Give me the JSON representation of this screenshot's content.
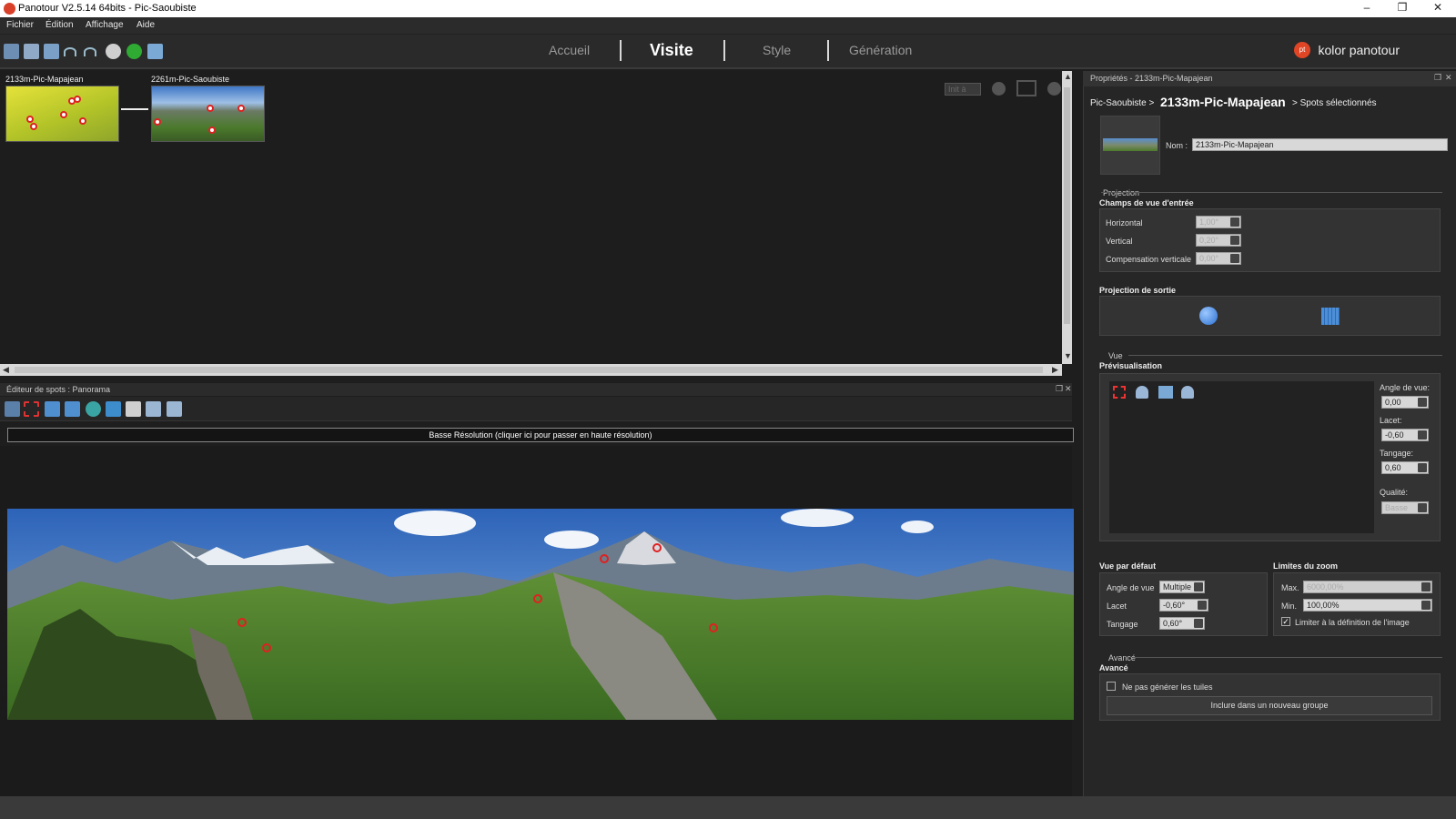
{
  "window": {
    "title": "Panotour V2.5.14 64bits - Pic-Saoubiste",
    "controls": [
      "–",
      "❐",
      "✕"
    ]
  },
  "menu": [
    "Fichier",
    "Édition",
    "Affichage",
    "Aide"
  ],
  "nav": {
    "tabs": [
      "Accueil",
      "Visite",
      "Style",
      "Génération"
    ],
    "active": "Visite",
    "brand": "kolor panotour",
    "brand_logo": "pt"
  },
  "tour": {
    "panos": [
      {
        "label": "2133m-Pic-Mapajean"
      },
      {
        "label": "2261m-Pic-Saoubiste"
      }
    ],
    "zoom_label": "Init à"
  },
  "editor": {
    "title": "Éditeur de spots : Panorama",
    "lowres_banner": "Basse Résolution (cliquer ici pour passer en haute résolution)"
  },
  "props": {
    "title": "Propriétés - 2133m-Pic-Mapajean",
    "breadcrumb_parent": "Pic-Saoubiste >",
    "breadcrumb_current": "2133m-Pic-Mapajean",
    "breadcrumb_tail": "> Spots sélectionnés",
    "name_label": "Nom :",
    "name_value": "2133m-Pic-Mapajean",
    "projection": {
      "section": "Projection",
      "group": "Champs de vue d'entrée",
      "horizontal_label": "Horizontal",
      "horizontal_value": "1,00°",
      "vertical_label": "Vertical",
      "vertical_value": "0,20°",
      "comp_label": "Compensation verticale",
      "comp_value": "0,00°",
      "output_label": "Projection de sortie"
    },
    "vue": {
      "section": "Vue",
      "group": "Prévisualisation",
      "angle_label": "Angle de vue:",
      "angle_value": "0,00",
      "lacet_label": "Lacet:",
      "lacet_value": "-0,60",
      "tangage_label": "Tangage:",
      "tangage_value": "0,60",
      "qualite_label": "Qualité:",
      "qualite_value": "Basse"
    },
    "default_view": {
      "group": "Vue par défaut",
      "angle_label": "Angle de vue",
      "angle_value": "Multiple",
      "lacet_label": "Lacet",
      "lacet_value": "-0,60°",
      "tangage_label": "Tangage",
      "tangage_value": "0,60°"
    },
    "zoom_limits": {
      "group": "Limites du zoom",
      "max_label": "Max.",
      "max_value": "6000,00%",
      "min_label": "Min.",
      "min_value": "100,00%",
      "limit_label": "Limiter à la définition de l'image"
    },
    "advanced": {
      "section": "Avancé",
      "group": "Avancé",
      "tiles_label": "Ne pas générer les tuiles",
      "group_button": "Inclure dans un nouveau groupe"
    }
  }
}
